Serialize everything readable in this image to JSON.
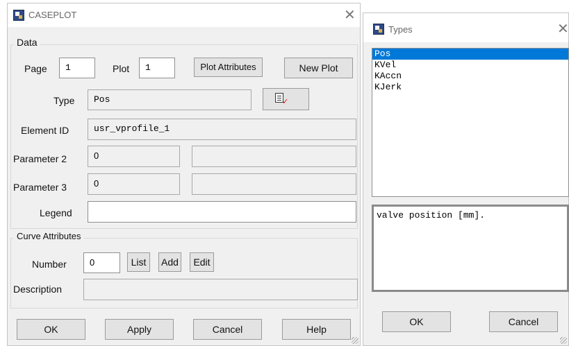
{
  "caseplot": {
    "title": "CASEPLOT",
    "data_group_label": "Data",
    "page_label": "Page",
    "page_value": "1",
    "plot_label": "Plot",
    "plot_value": "1",
    "plot_attributes_button": "Plot Attributes",
    "new_plot_button": "New Plot",
    "type_label": "Type",
    "type_value": "Pos",
    "element_id_label": "Element ID",
    "element_id_value": "usr_vprofile_1",
    "parameter2_label": "Parameter 2",
    "parameter2_value": "0",
    "parameter2_extra": "",
    "parameter3_label": "Parameter 3",
    "parameter3_value": "0",
    "parameter3_extra": "",
    "legend_label": "Legend",
    "legend_value": "",
    "curve_group_label": "Curve Attributes",
    "number_label": "Number",
    "number_value": "0",
    "list_button": "List",
    "add_button": "Add",
    "edit_button": "Edit",
    "description_label": "Description",
    "description_value": "",
    "ok_button": "OK",
    "apply_button": "Apply",
    "cancel_button": "Cancel",
    "help_button": "Help"
  },
  "types": {
    "title": "Types",
    "items": [
      "Pos",
      "KVel",
      "KAccn",
      "KJerk"
    ],
    "selected": "Pos",
    "description": "valve position [mm].",
    "ok_button": "OK",
    "cancel_button": "Cancel"
  },
  "colors": {
    "selection": "#0078d7",
    "dialog_bg": "#f0f0f0",
    "brand_icon": "#2e4a86"
  },
  "icons": {
    "app": "app-icon",
    "close": "close-icon",
    "type_picker": "edit-list-icon"
  }
}
